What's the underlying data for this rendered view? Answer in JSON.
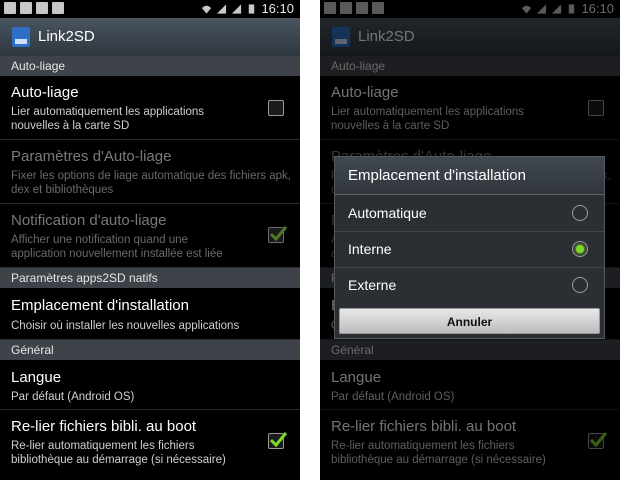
{
  "status_bar": {
    "time": "16:10"
  },
  "app": {
    "title": "Link2SD"
  },
  "sections": {
    "auto_link": "Auto-liage",
    "native_a2sd": "Paramètres apps2SD natifs",
    "general": "Général"
  },
  "items": {
    "auto_link": {
      "title": "Auto-liage",
      "summary": "Lier automatiquement les applications nouvelles à la carte SD",
      "checked": false
    },
    "auto_link_settings": {
      "title": "Paramètres d'Auto-liage",
      "summary": "Fixer les options de liage automatique des fichiers apk, dex et bibliothèques"
    },
    "auto_link_notification": {
      "title": "Notification d'auto-liage",
      "summary": "Afficher une notification quand une application nouvellement installée est liée",
      "checked": true
    },
    "install_location": {
      "title": "Emplacement d'installation",
      "summary": "Choisir où installer les nouvelles applications"
    },
    "language": {
      "title": "Langue",
      "summary": "Par défaut (Android OS)"
    },
    "relink_boot": {
      "title": "Re-lier fichiers bibli. au boot",
      "summary": "Re-lier automatiquement les fichiers bibliothèque au démarrage (si nécessaire)",
      "checked": true
    }
  },
  "dialog": {
    "title": "Emplacement d'installation",
    "options": [
      {
        "label": "Automatique",
        "selected": false
      },
      {
        "label": "Interne",
        "selected": true
      },
      {
        "label": "Externe",
        "selected": false
      }
    ],
    "cancel_label": "Annuler"
  },
  "colors": {
    "accent_check": "#7cd82a",
    "titlebar": "#3a434c",
    "section": "#3e4349"
  }
}
